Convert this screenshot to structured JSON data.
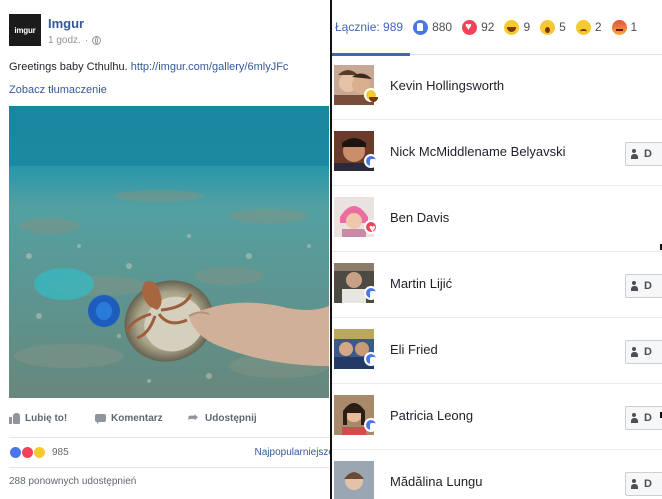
{
  "post": {
    "page_name": "Imgur",
    "logo_text": "imgur",
    "time": "1 godz.",
    "text": "Greetings baby Cthulhu.",
    "link": "http://imgur.com/gallery/6mlyJFc",
    "translate": "Zobacz tłumaczenie",
    "actions": {
      "like": "Lubię to!",
      "comment": "Komentarz",
      "share": "Udostępnij"
    },
    "reaction_count": "985",
    "sort": "Najpopularniejsze",
    "shares": "288 ponownych udostępnień"
  },
  "reactions": {
    "tabs": [
      {
        "label": "Łącznie: 989",
        "icon": ""
      },
      {
        "label": "880",
        "icon": "like-icon"
      },
      {
        "label": "92",
        "icon": "love-icon"
      },
      {
        "label": "9",
        "icon": "haha-icon"
      },
      {
        "label": "5",
        "icon": "wow-icon"
      },
      {
        "label": "2",
        "icon": "sad-icon"
      },
      {
        "label": "1",
        "icon": "angry-icon"
      }
    ],
    "add_friend_label": "D",
    "people": [
      {
        "name": "Kevin Hollingsworth",
        "reaction": "haha",
        "has_button": false
      },
      {
        "name": "Nick McMiddlename Belyavski",
        "reaction": "like",
        "has_button": true
      },
      {
        "name": "Ben Davis",
        "reaction": "love",
        "has_button": false
      },
      {
        "name": "Martin Lijić",
        "reaction": "like",
        "has_button": true
      },
      {
        "name": "Eli Fried",
        "reaction": "like",
        "has_button": true
      },
      {
        "name": "Patricia Leong",
        "reaction": "like",
        "has_button": true
      },
      {
        "name": "Mădălina Lungu",
        "reaction": "like",
        "has_button": true
      }
    ]
  },
  "colors": {
    "link": "#365899",
    "accent": "#4267b2",
    "like": "#4a76ea",
    "love": "#f0435a",
    "haha": "#f7c930"
  }
}
